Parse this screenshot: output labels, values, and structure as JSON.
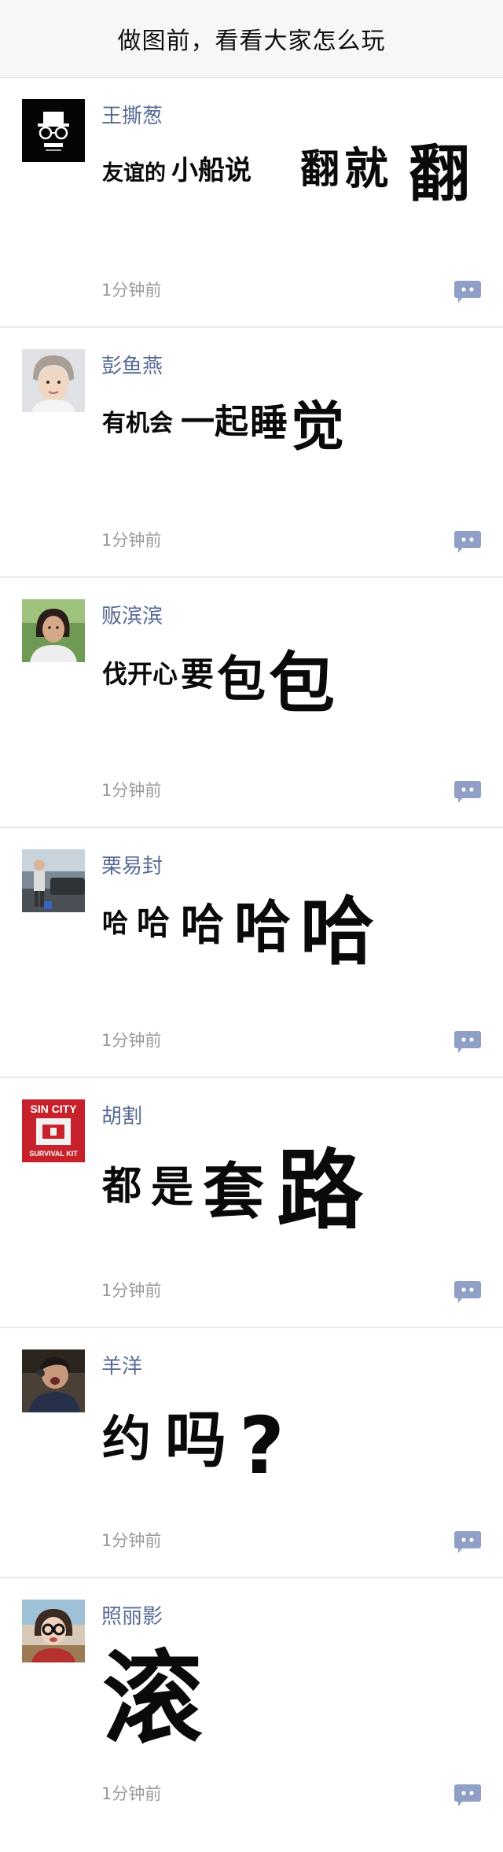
{
  "header": {
    "title": "做图前，看看大家怎么玩"
  },
  "posts": [
    {
      "name": "王撕葱",
      "time": "1分钟前",
      "avatar_icon": "sunglasses-logo",
      "segments": [
        "友谊的",
        "小船说",
        "翻",
        "就",
        "翻"
      ]
    },
    {
      "name": "彭鱼燕",
      "time": "1分钟前",
      "avatar_icon": "portrait",
      "segments": [
        "有机会",
        "一起",
        "睡",
        "觉"
      ]
    },
    {
      "name": "贩滨滨",
      "time": "1分钟前",
      "avatar_icon": "portrait",
      "segments": [
        "伐开心",
        "要",
        "包",
        "包"
      ]
    },
    {
      "name": "栗易封",
      "time": "1分钟前",
      "avatar_icon": "photo",
      "segments": [
        "哈",
        "哈",
        "哈",
        "哈",
        "哈"
      ]
    },
    {
      "name": "胡割",
      "time": "1分钟前",
      "avatar_icon": "sin-city-logo",
      "avatar_text": [
        "SIN CITY",
        "SURVIVAL KIT"
      ],
      "segments": [
        "都",
        "是",
        "套",
        "路"
      ]
    },
    {
      "name": "羊洋",
      "time": "1分钟前",
      "avatar_icon": "portrait",
      "segments": [
        "约",
        "吗",
        "?"
      ]
    },
    {
      "name": "照丽影",
      "time": "1分钟前",
      "avatar_icon": "portrait",
      "segments": [
        "滚"
      ]
    }
  ],
  "colors": {
    "name": "#576b95",
    "time": "#9a9a9a",
    "comment_icon": "#8f9fc6"
  }
}
